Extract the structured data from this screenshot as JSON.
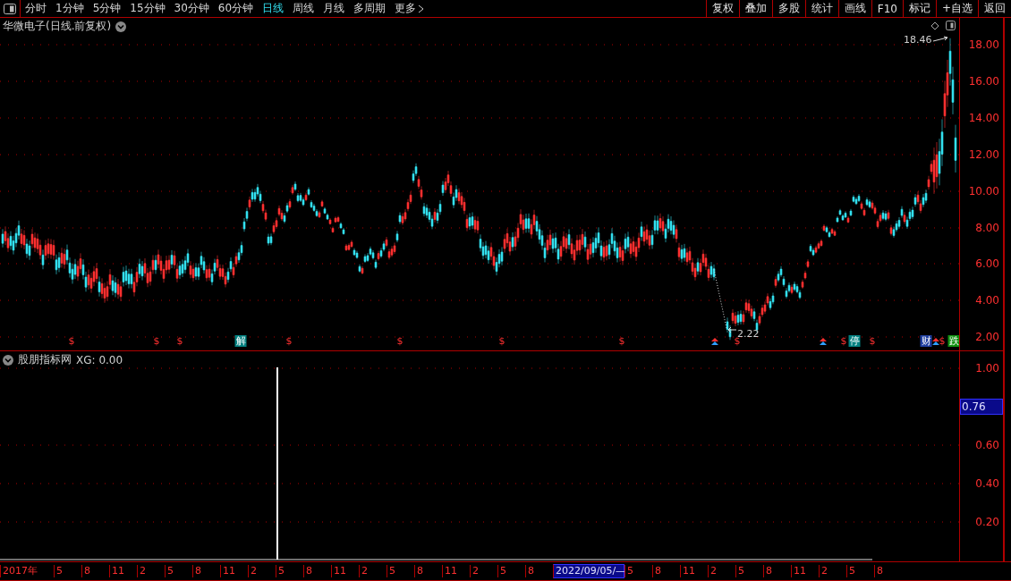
{
  "toolbar": {
    "periods": [
      {
        "label": "分时",
        "selected": false
      },
      {
        "label": "1分钟",
        "selected": false
      },
      {
        "label": "5分钟",
        "selected": false
      },
      {
        "label": "15分钟",
        "selected": false
      },
      {
        "label": "30分钟",
        "selected": false
      },
      {
        "label": "60分钟",
        "selected": false
      },
      {
        "label": "日线",
        "selected": true
      },
      {
        "label": "周线",
        "selected": false
      },
      {
        "label": "月线",
        "selected": false
      },
      {
        "label": "多周期",
        "selected": false
      },
      {
        "label": "更多",
        "selected": false
      }
    ],
    "buttons": [
      "复权",
      "叠加",
      "多股",
      "统计",
      "画线",
      "F10",
      "标记",
      "+自选",
      "返回"
    ]
  },
  "price_chart": {
    "title": "华微电子(日线.前复权)",
    "high_label": "18.46",
    "low_label": "2.22",
    "y_axis": [
      "18.00",
      "16.00",
      "14.00",
      "12.00",
      "10.00",
      "8.00",
      "6.00",
      "4.00",
      "2.00"
    ],
    "markers": [
      {
        "kind": "signal",
        "text": "$"
      },
      {
        "kind": "signal",
        "text": "$"
      },
      {
        "kind": "signal",
        "text": "$"
      },
      {
        "kind": "event",
        "text": "解",
        "color": "#008080"
      },
      {
        "kind": "signal",
        "text": "$"
      },
      {
        "kind": "signal",
        "text": "$"
      },
      {
        "kind": "signal",
        "text": "$"
      },
      {
        "kind": "signal",
        "text": "$"
      },
      {
        "kind": "arrow"
      },
      {
        "kind": "signal",
        "text": "$"
      },
      {
        "kind": "arrow"
      },
      {
        "kind": "signal",
        "text": "$"
      },
      {
        "kind": "event",
        "text": "停",
        "color": "#008080"
      },
      {
        "kind": "signal",
        "text": "$"
      },
      {
        "kind": "event",
        "text": "财",
        "color": "#1f3fa0"
      },
      {
        "kind": "arrow"
      },
      {
        "kind": "signal",
        "text": "$"
      },
      {
        "kind": "event",
        "text": "跌",
        "color": "#109010"
      }
    ]
  },
  "indicator": {
    "title": "股朋指标网",
    "reading": "XG: 0.00",
    "y_axis": [
      "1.00",
      "0.60",
      "0.40",
      "0.20"
    ],
    "cursor_value": "0.76"
  },
  "x_axis": {
    "labels": [
      {
        "text": "2017年",
        "selected": false
      },
      {
        "text": "5",
        "selected": false
      },
      {
        "text": "8",
        "selected": false
      },
      {
        "text": "11",
        "selected": false
      },
      {
        "text": "2",
        "selected": false
      },
      {
        "text": "5",
        "selected": false
      },
      {
        "text": "8",
        "selected": false
      },
      {
        "text": "11",
        "selected": false
      },
      {
        "text": "2",
        "selected": false
      },
      {
        "text": "5",
        "selected": false
      },
      {
        "text": "8",
        "selected": false
      },
      {
        "text": "11",
        "selected": false
      },
      {
        "text": "2",
        "selected": false
      },
      {
        "text": "5",
        "selected": false
      },
      {
        "text": "8",
        "selected": false
      },
      {
        "text": "11",
        "selected": false
      },
      {
        "text": "2",
        "selected": false
      },
      {
        "text": "5",
        "selected": false
      },
      {
        "text": "8",
        "selected": false
      },
      {
        "text": "2022/09/05/—",
        "selected": true
      },
      {
        "text": "5",
        "selected": false
      },
      {
        "text": "8",
        "selected": false
      },
      {
        "text": "11",
        "selected": false
      },
      {
        "text": "2",
        "selected": false
      },
      {
        "text": "5",
        "selected": false
      },
      {
        "text": "8",
        "selected": false
      },
      {
        "text": "11",
        "selected": false
      },
      {
        "text": "2",
        "selected": false
      },
      {
        "text": "5",
        "selected": false
      },
      {
        "text": "8",
        "selected": false
      }
    ]
  }
}
